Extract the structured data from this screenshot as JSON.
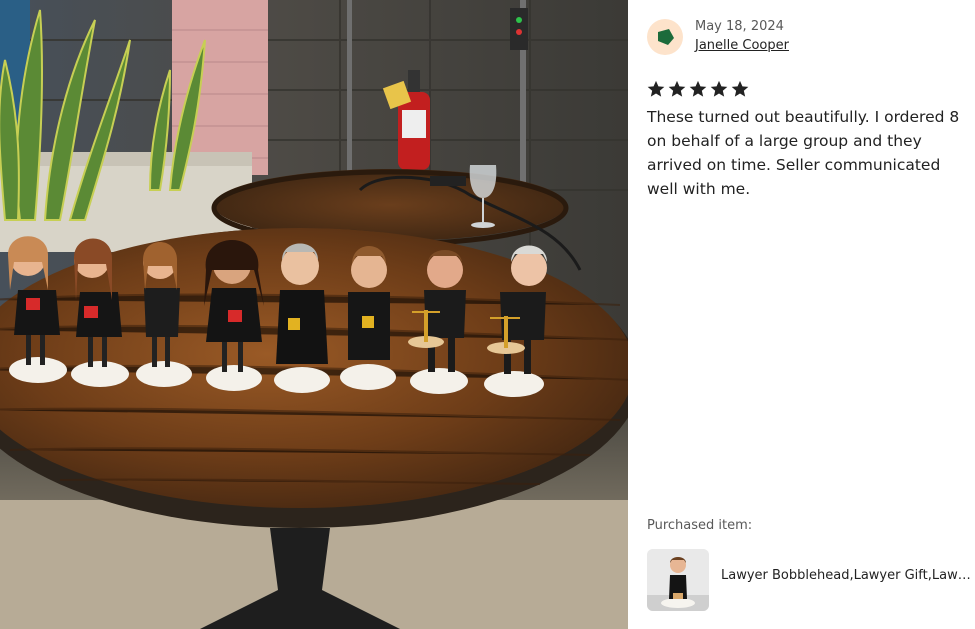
{
  "photo": {
    "description_icon": "review-photo-icon"
  },
  "review": {
    "date": "May 18, 2024",
    "reviewer_name": "Janelle Cooper",
    "rating": 5,
    "rating_max": 5,
    "text": "These turned out beautifully. I ordered 8 on behalf of a large group and they arrived on time. Seller communicated well with me.",
    "avatar_icon": "user-avatar-icon",
    "star_color": "#222222",
    "avatar_bg": "#fde3cb",
    "avatar_shape_color": "#1c6b3b"
  },
  "purchased": {
    "label": "Purchased item:",
    "item_title": "Lawyer Bobblehead,Lawyer Gift,Lawyer Gift for Women"
  }
}
